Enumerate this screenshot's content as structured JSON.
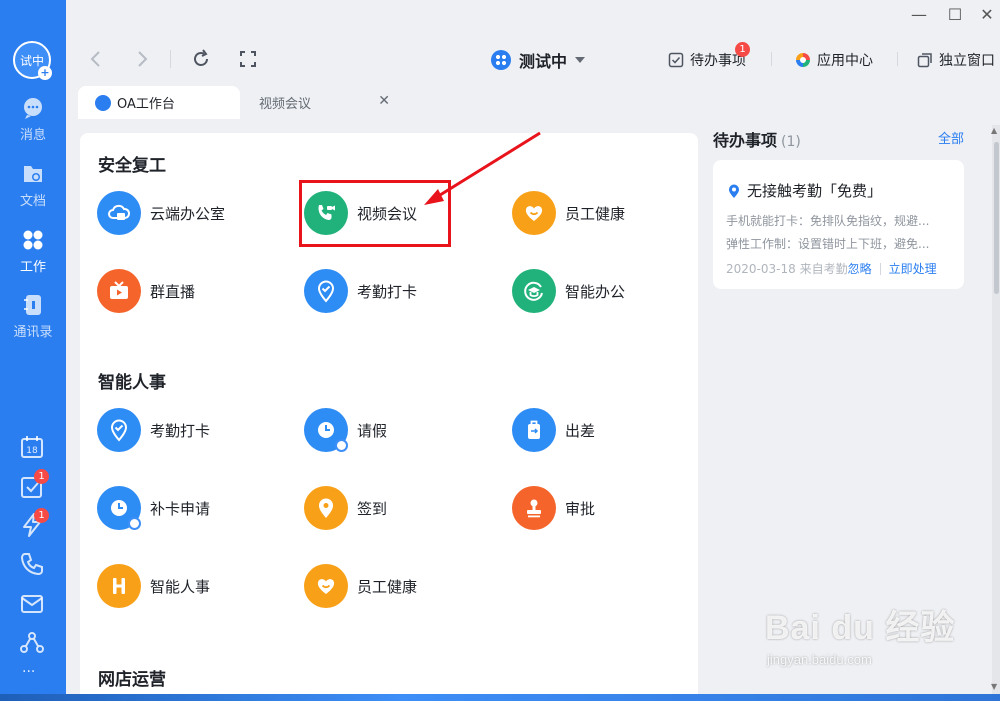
{
  "window": {
    "minimize": "—",
    "maximize": "☐",
    "close": "✕"
  },
  "user": {
    "avatar_text": "试中",
    "avatar_plus": "+"
  },
  "sidebar": {
    "items": [
      {
        "label": "消息",
        "icon": "message-icon"
      },
      {
        "label": "文档",
        "icon": "document-icon"
      },
      {
        "label": "工作",
        "icon": "work-grid-icon"
      },
      {
        "label": "通讯录",
        "icon": "contacts-icon"
      }
    ],
    "bottom_icons": [
      {
        "icon": "calendar-icon",
        "text": "18"
      },
      {
        "icon": "task-check-icon",
        "badge": "1"
      },
      {
        "icon": "lightning-icon",
        "badge": "1"
      },
      {
        "icon": "phone-icon"
      },
      {
        "icon": "mail-icon"
      },
      {
        "icon": "network-icon"
      },
      {
        "icon": "more-icon",
        "text": "···"
      }
    ]
  },
  "topbar": {
    "title": "测试中",
    "todo_label": "待办事项",
    "todo_badge": "1",
    "app_center_label": "应用中心",
    "standalone_label": "独立窗口"
  },
  "tabs": [
    {
      "label": "OA工作台",
      "active": true
    },
    {
      "label": "视频会议",
      "active": false,
      "close": "✕"
    }
  ],
  "sections": [
    {
      "title": "安全复工",
      "apps": [
        "云端办公室",
        "视频会议",
        "员工健康",
        "群直播",
        "考勤打卡",
        "智能办公"
      ]
    },
    {
      "title": "智能人事",
      "apps": [
        "考勤打卡",
        "请假",
        "出差",
        "补卡申请",
        "签到",
        "审批",
        "智能人事",
        "员工健康"
      ]
    },
    {
      "title": "网店运营",
      "apps": []
    }
  ],
  "todo": {
    "heading": "待办事项",
    "count": "(1)",
    "all_label": "全部",
    "item": {
      "title": "无接触考勤「免费」",
      "line1": "手机就能打卡：免排队免指纹，规避...",
      "line2": "弹性工作制：设置错时上下班，避免...",
      "date": "2020-03-18",
      "source": "来自考勤",
      "ignore_label": "忽略",
      "handle_label": "立即处理"
    }
  },
  "watermark": {
    "main": "Bai du 经验",
    "sub": "jingyan.baidu.com"
  },
  "colors": {
    "rail": "#2a7ef0",
    "accent": "#2a7ef0",
    "highlight": "#e8131b",
    "blue_icon": "#2e8cf5",
    "green_icon": "#21b27b",
    "orange_icon": "#f8a018",
    "red_orange_icon": "#f5642b"
  }
}
